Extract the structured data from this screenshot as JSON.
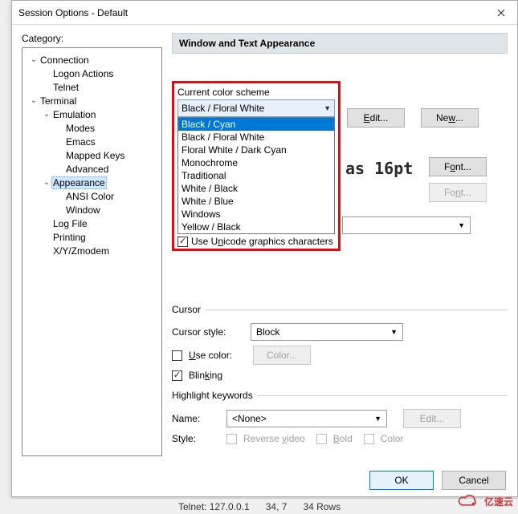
{
  "title": "Session Options - Default",
  "category_label": "Category:",
  "tree": [
    {
      "label": "Connection",
      "indent": 0,
      "toggle": "v"
    },
    {
      "label": "Logon Actions",
      "indent": 1,
      "toggle": ""
    },
    {
      "label": "Telnet",
      "indent": 1,
      "toggle": ""
    },
    {
      "label": "Terminal",
      "indent": 0,
      "toggle": "v"
    },
    {
      "label": "Emulation",
      "indent": 1,
      "toggle": "v"
    },
    {
      "label": "Modes",
      "indent": 2,
      "toggle": ""
    },
    {
      "label": "Emacs",
      "indent": 2,
      "toggle": ""
    },
    {
      "label": "Mapped Keys",
      "indent": 2,
      "toggle": ""
    },
    {
      "label": "Advanced",
      "indent": 2,
      "toggle": ""
    },
    {
      "label": "Appearance",
      "indent": 1,
      "toggle": "v",
      "selected": true
    },
    {
      "label": "ANSI Color",
      "indent": 2,
      "toggle": ""
    },
    {
      "label": "Window",
      "indent": 2,
      "toggle": ""
    },
    {
      "label": "Log File",
      "indent": 1,
      "toggle": ""
    },
    {
      "label": "Printing",
      "indent": 1,
      "toggle": ""
    },
    {
      "label": "X/Y/Zmodem",
      "indent": 1,
      "toggle": ""
    }
  ],
  "section_title": "Window and Text Appearance",
  "scheme_label": "Current color scheme",
  "scheme_selected": "Black / Floral White",
  "scheme_options": [
    "Black / Cyan",
    "Black / Floral White",
    "Floral White / Dark Cyan",
    "Monochrome",
    "Traditional",
    "White / Black",
    "White / Blue",
    "Windows",
    "Yellow / Black"
  ],
  "unicode_label": "Use Unicode graphics characters",
  "edit_btn": "Edit...",
  "new_btn": "New...",
  "font_preview": "as 16pt",
  "font_btn": "Font...",
  "cursor": {
    "title": "Cursor",
    "style_label": "Cursor style:",
    "style_value": "Block",
    "use_color_label": "Use color:",
    "color_btn": "Color...",
    "blinking_label": "Blinking"
  },
  "highlight": {
    "title": "Highlight keywords",
    "name_label": "Name:",
    "name_value": "<None>",
    "edit_btn": "Edit...",
    "style_label": "Style:",
    "reverse": "Reverse video",
    "bold": "Bold",
    "color": "Color"
  },
  "ok_btn": "OK",
  "cancel_btn": "Cancel",
  "status": {
    "left": "Telnet: 127.0.0.1",
    "mid": "34,  7",
    "right": "34 Rows"
  },
  "watermark": "亿速云"
}
